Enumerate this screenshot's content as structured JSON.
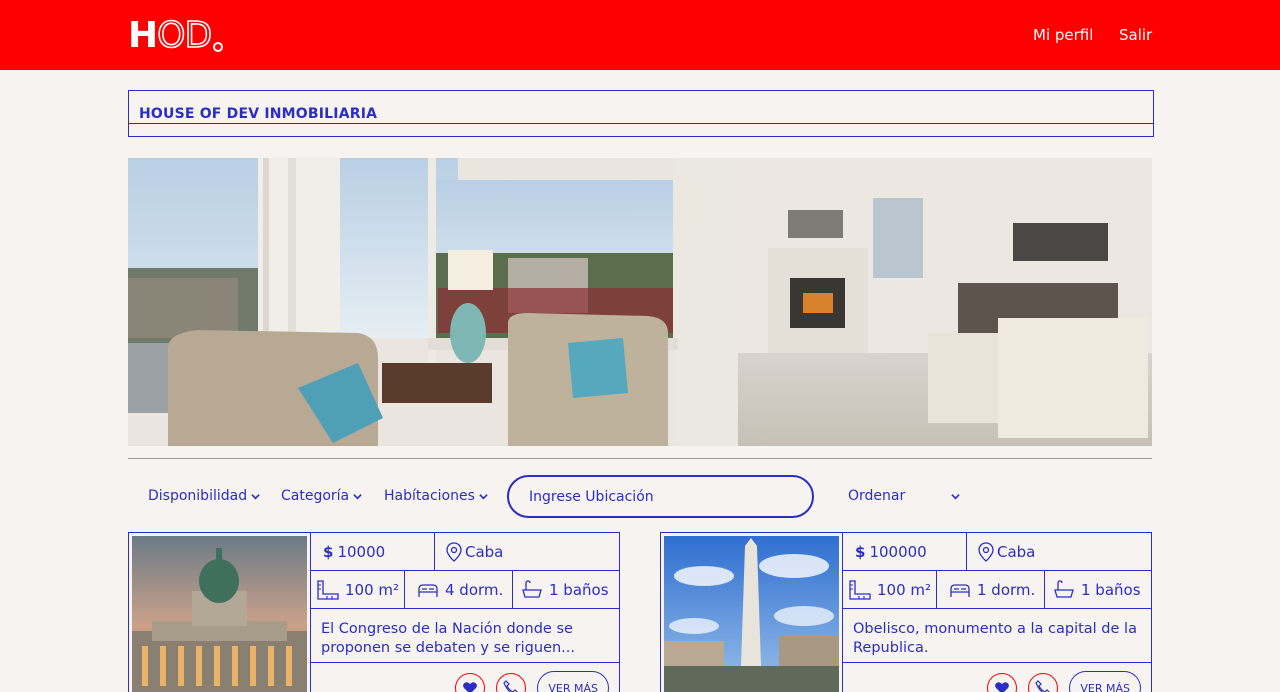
{
  "header": {
    "logo": {
      "letter": "H",
      "rest": "OD"
    },
    "nav": {
      "profile": "Mi perfil",
      "logout": "Salir"
    },
    "bg_color": "#ff0000"
  },
  "page_title": "HOUSE OF DEV INMOBILIARIA",
  "hero": {
    "icon": "living-room-photo"
  },
  "filters": {
    "availability": "Disponibilidad",
    "category": "Categoría",
    "rooms": "Habítaciones",
    "location_placeholder": "Ingrese Ubicación",
    "order": "Ordenar"
  },
  "properties": [
    {
      "currency": "$",
      "price": "10000",
      "location": "Caba",
      "area": "100 m²",
      "bedrooms": "4 dorm.",
      "bathrooms": "1 baños",
      "description": "El Congreso de la Nación donde se proponen se debaten y se riguen...",
      "more_label": "VER MÁS",
      "photo": "congreso-photo"
    },
    {
      "currency": "$",
      "price": "100000",
      "location": "Caba",
      "area": "100 m²",
      "bedrooms": "1 dorm.",
      "bathrooms": "1 baños",
      "description": "Obelisco, monumento a la capital de la Republica.",
      "more_label": "VER MÁS",
      "photo": "obelisco-photo"
    }
  ],
  "colors": {
    "accent": "#2b2ec4",
    "brand": "#ff0000",
    "background": "#f6f3f0"
  }
}
